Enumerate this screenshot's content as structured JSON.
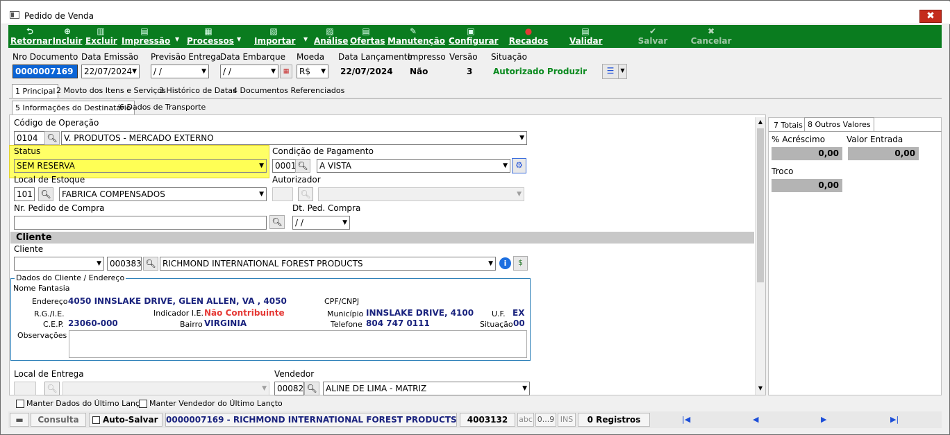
{
  "window": {
    "title": "Pedido de Venda",
    "close_glyph": "✖"
  },
  "toolbar": {
    "retornar": "Retornar",
    "incluir": "Incluir",
    "excluir": "Excluir",
    "impressao": "Impressão",
    "processos": "Processos",
    "importar": "Importar",
    "analise": "Análise",
    "ofertas": "Ofertas",
    "manutencao": "Manutenção",
    "configurar": "Configurar",
    "recados": "Recados",
    "validar": "Validar",
    "salvar": "Salvar",
    "cancelar": "Cancelar"
  },
  "header": {
    "nro_documento_label": "Nro Documento",
    "nro_documento": "0000007169",
    "data_emissao_label": "Data Emissão",
    "data_emissao": "22/07/2024",
    "previsao_entrega_label": "Previsão Entrega",
    "previsao_entrega": " / /",
    "data_embarque_label": "Data Embarque",
    "data_embarque": " / /",
    "moeda_label": "Moeda",
    "moeda": "R$",
    "data_lancamento_label": "Data Lançamento",
    "data_lancamento": "22/07/2024",
    "impresso_label": "Impresso",
    "impresso": "Não",
    "versao_label": "Versão",
    "versao": "3",
    "situacao_label": "Situação",
    "situacao": "Autorizado Produzir",
    "situacao_color": "#0a8a1f"
  },
  "tabs": [
    "1 Principal",
    "2 Movto dos Itens e Serviços",
    "3 Histórico de Datas",
    "4 Documentos Referenciados"
  ],
  "subtabs": [
    "5 Informações do Destinatário",
    "6 Dados de Transporte"
  ],
  "form": {
    "codigo_operacao_label": "Código de Operação",
    "codigo_operacao_code": "0104",
    "codigo_operacao_desc": "V. PRODUTOS - MERCADO EXTERNO",
    "status_label": "Status",
    "status_value": "SEM RESERVA",
    "status_highlight": "#ffff66",
    "condicao_pagamento_label": "Condição de Pagamento",
    "condicao_code": "0001",
    "condicao_desc": "A VISTA",
    "local_estoque_label": "Local de Estoque",
    "local_estoque_code": "101",
    "local_estoque_desc": "FABRICA COMPENSADOS",
    "autorizador_label": "Autorizador",
    "nr_pedido_compra_label": "Nr. Pedido de Compra",
    "dt_ped_compra_label": "Dt. Ped. Compra",
    "dt_ped_compra": " / /",
    "cliente_section": "Cliente",
    "cliente_label": "Cliente",
    "cliente_code": "0003834",
    "cliente_name": "RICHMOND INTERNATIONAL FOREST PRODUCTS",
    "dados_cliente_legend": "Dados do Cliente / Endereço",
    "nome_fantasia_label": "Nome Fantasia",
    "endereco_label": "Endereço",
    "endereco": "4050 INNSLAKE DRIVE, GLEN ALLEN, VA , 4050",
    "cpf_cnpj_label": "CPF/CNPJ",
    "rg_ie_label": "R.G./I.E.",
    "indicador_ie_label": "Indicador I.E.",
    "indicador_ie": "Não Contribuinte",
    "municipio_label": "Município",
    "municipio": "INNSLAKE DRIVE, 4100",
    "uf_label": "U.F.",
    "uf": "EX",
    "cep_label": "C.E.P.",
    "cep": "23060-000",
    "bairro_label": "Bairro",
    "bairro": "VIRGINIA",
    "telefone_label": "Telefone",
    "telefone": "804 747 0111",
    "situacao_label": "Situação",
    "situacao": "00",
    "observacoes_label": "Observações",
    "local_entrega_label": "Local de Entrega",
    "vendedor_label": "Vendedor",
    "vendedor_code": "00082",
    "vendedor_name": "ALINE DE LIMA - MATRIZ"
  },
  "right_panel": {
    "tabs": [
      "7 Totais",
      "8 Outros Valores"
    ],
    "acrescimo_label": "% Acréscimo",
    "acrescimo": "0,00",
    "valor_entrada_label": "Valor Entrada",
    "valor_entrada": "0,00",
    "troco_label": "Troco",
    "troco": "0,00"
  },
  "checkboxes": {
    "manter_dados": "Manter Dados do Último Lançto",
    "manter_vendedor": "Manter Vendedor do Último Lançto"
  },
  "statusbar": {
    "mode": "Consulta",
    "auto_salvar": "Auto-Salvar",
    "record_text": "0000007169 - RICHMOND INTERNATIONAL FOREST PRODUCTS",
    "record_id": "4003132",
    "abc": "abc",
    "digits": "0...9",
    "ins": "INS",
    "registros": "0 Registros"
  }
}
